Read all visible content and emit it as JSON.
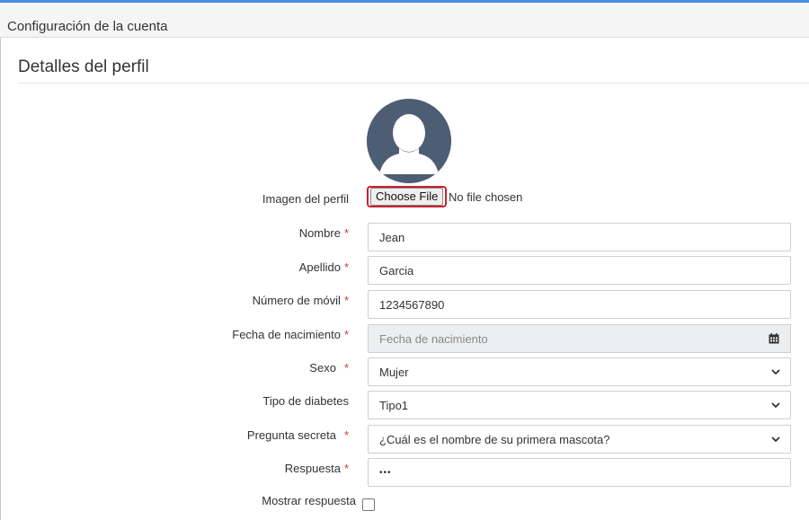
{
  "header": {
    "title": "Configuración de la cuenta"
  },
  "section": {
    "title": "Detalles del perfil"
  },
  "profile_image": {
    "label": "Imagen del perfil",
    "button_label": "Choose File",
    "status": "No file chosen"
  },
  "form": {
    "nombre": {
      "label": "Nombre",
      "required_mark": "*",
      "value": "Jean"
    },
    "apellido": {
      "label": "Apellido",
      "required_mark": "*",
      "value": "Garcia"
    },
    "movil": {
      "label": "Número de móvil",
      "required_mark": "*",
      "value": "1234567890"
    },
    "fecha": {
      "label": "Fecha de nacimiento",
      "required_mark": "*",
      "placeholder": "Fecha de nacimiento"
    },
    "sexo": {
      "label": "Sexo",
      "required_mark": "*",
      "value": "Mujer"
    },
    "diabetes": {
      "label": "Tipo de diabetes",
      "value": "Tipo1"
    },
    "pregunta": {
      "label": "Pregunta secreta",
      "required_mark": "*",
      "value": "¿Cuál es el nombre de su primera mascota?"
    },
    "respuesta": {
      "label": "Respuesta",
      "required_mark": "*",
      "value": "•••"
    },
    "mostrar": {
      "label": "Mostrar respuesta",
      "checked": false
    }
  },
  "icons": {
    "avatar": "user-silhouette-icon",
    "calendar": "calendar-icon",
    "select": "chevron-down-icon"
  },
  "colors": {
    "accent": "#4a90e2",
    "avatar_bg": "#4d5d74",
    "required": "#d0392b",
    "highlight": "#c8202f"
  }
}
